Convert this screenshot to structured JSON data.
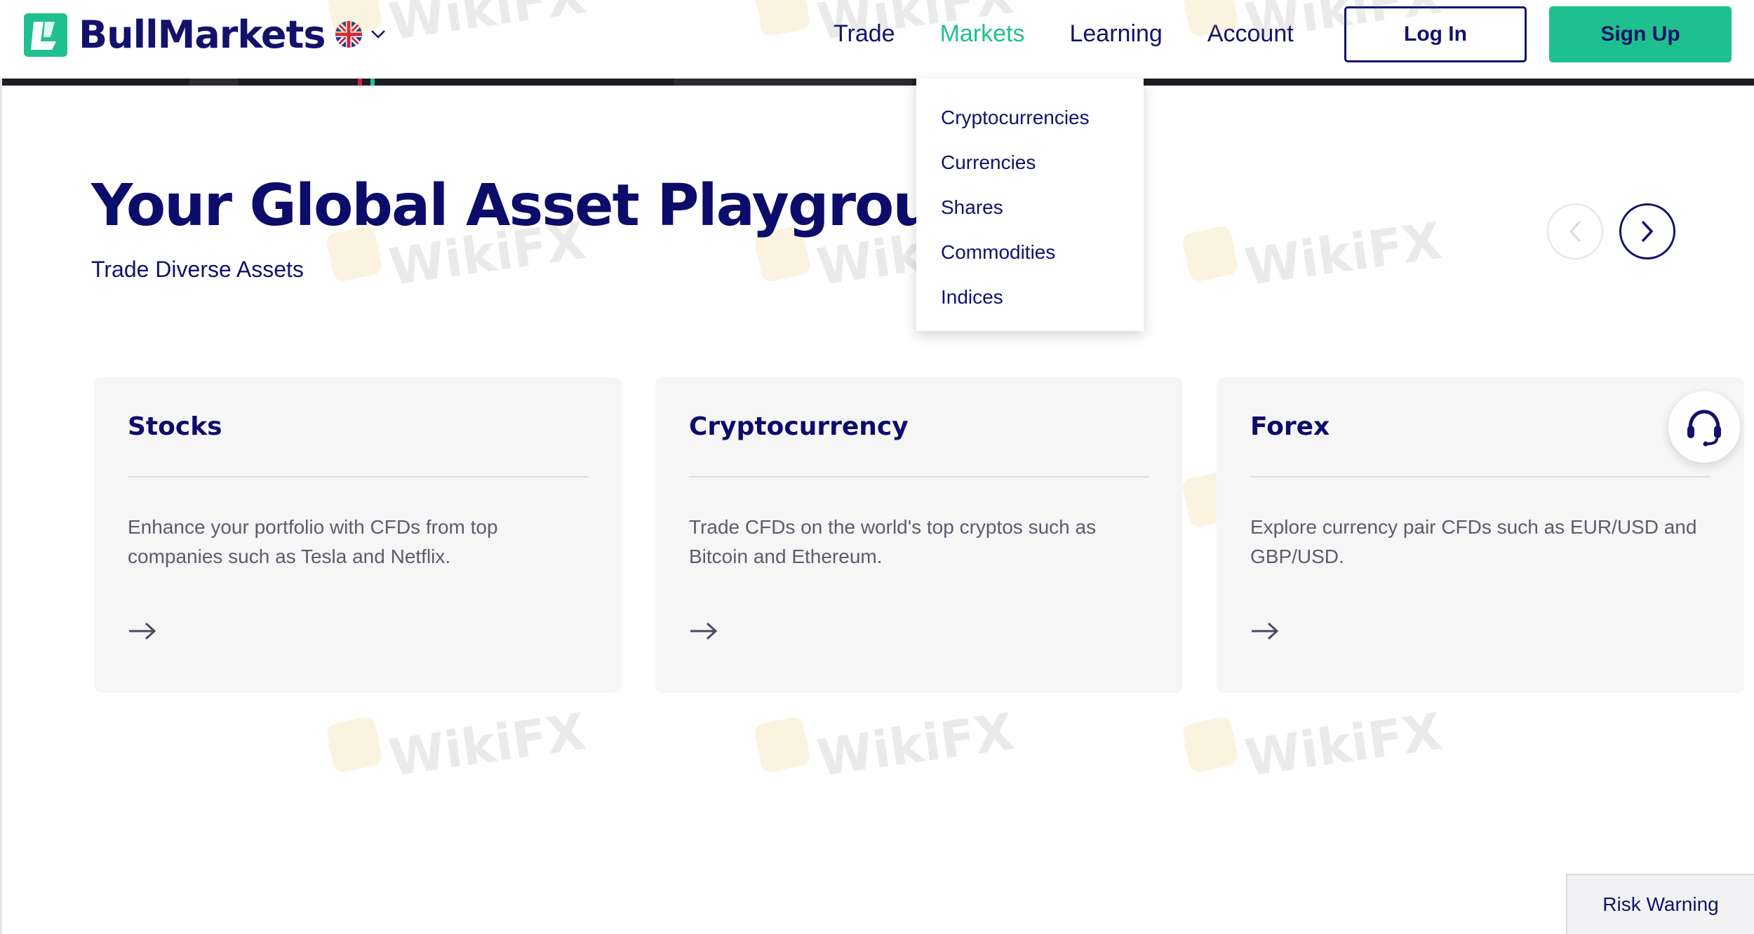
{
  "brand": {
    "name": "BullMarkets",
    "accent": "#1fc08f",
    "primary": "#12126b"
  },
  "nav": {
    "items": [
      {
        "label": "Trade",
        "active": false
      },
      {
        "label": "Markets",
        "active": true
      },
      {
        "label": "Learning",
        "active": false
      },
      {
        "label": "Account",
        "active": false
      }
    ],
    "login_label": "Log In",
    "signup_label": "Sign Up"
  },
  "language": {
    "icon": "uk-flag-icon"
  },
  "markets_menu": {
    "items": [
      "Cryptocurrencies",
      "Currencies",
      "Shares",
      "Commodities",
      "Indices"
    ]
  },
  "hero": {
    "title": "Your Global Asset Playground",
    "subtitle": "Trade Diverse Assets"
  },
  "cards": [
    {
      "title": "Stocks",
      "description": "Enhance your portfolio with CFDs from top companies such as Tesla and Netflix."
    },
    {
      "title": "Cryptocurrency",
      "description": "Trade CFDs on the world's top cryptos such as Bitcoin and Ethereum."
    },
    {
      "title": "Forex",
      "description": "Explore currency pair CFDs such as EUR/USD and GBP/USD."
    }
  ],
  "footer": {
    "risk_warning_label": "Risk Warning"
  },
  "watermark": {
    "text": "WikiFX"
  }
}
